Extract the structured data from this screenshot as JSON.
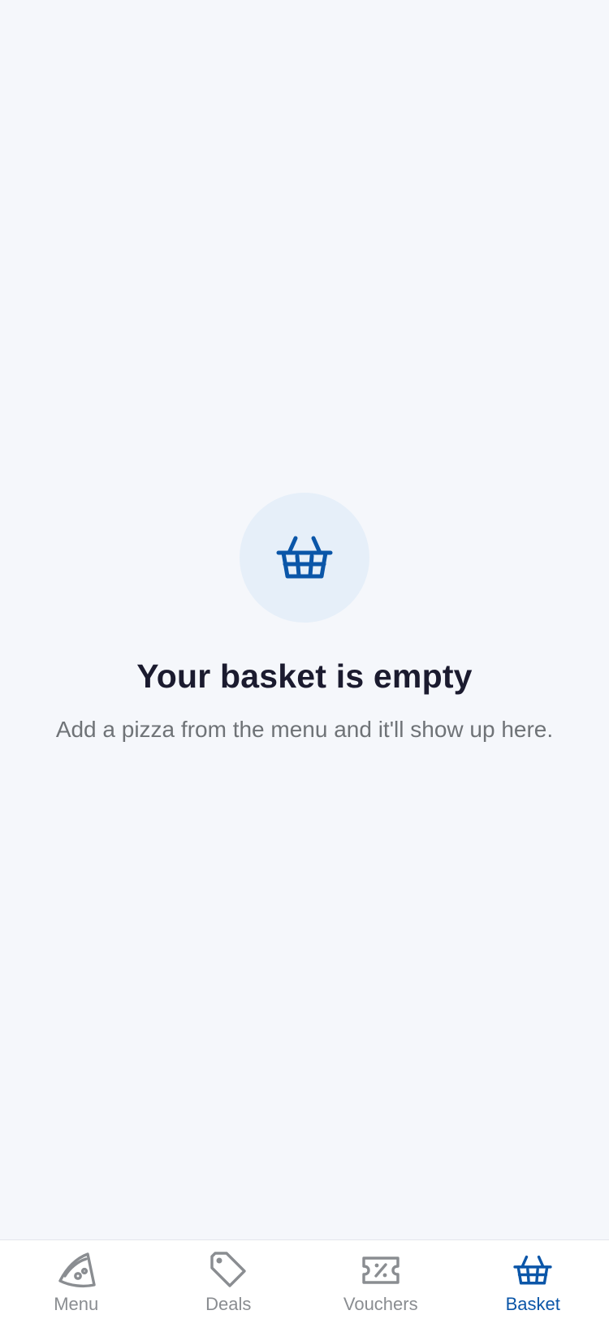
{
  "empty_state": {
    "icon": "basket-icon",
    "title": "Your basket is empty",
    "subtitle": "Add a pizza from the menu and it'll show up here."
  },
  "tabbar": {
    "active": "basket",
    "tabs": [
      {
        "id": "menu",
        "label": "Menu",
        "icon": "pizza-slice-icon"
      },
      {
        "id": "deals",
        "label": "Deals",
        "icon": "tag-icon"
      },
      {
        "id": "vouchers",
        "label": "Vouchers",
        "icon": "voucher-icon"
      },
      {
        "id": "basket",
        "label": "Basket",
        "icon": "basket-icon"
      }
    ]
  },
  "colors": {
    "background": "#f5f7fb",
    "accent": "#0b56a8",
    "icon_circle": "#e6eff9",
    "title": "#1b1b2f",
    "subtitle": "#6f7377",
    "inactive_tab": "#8a8d91"
  }
}
